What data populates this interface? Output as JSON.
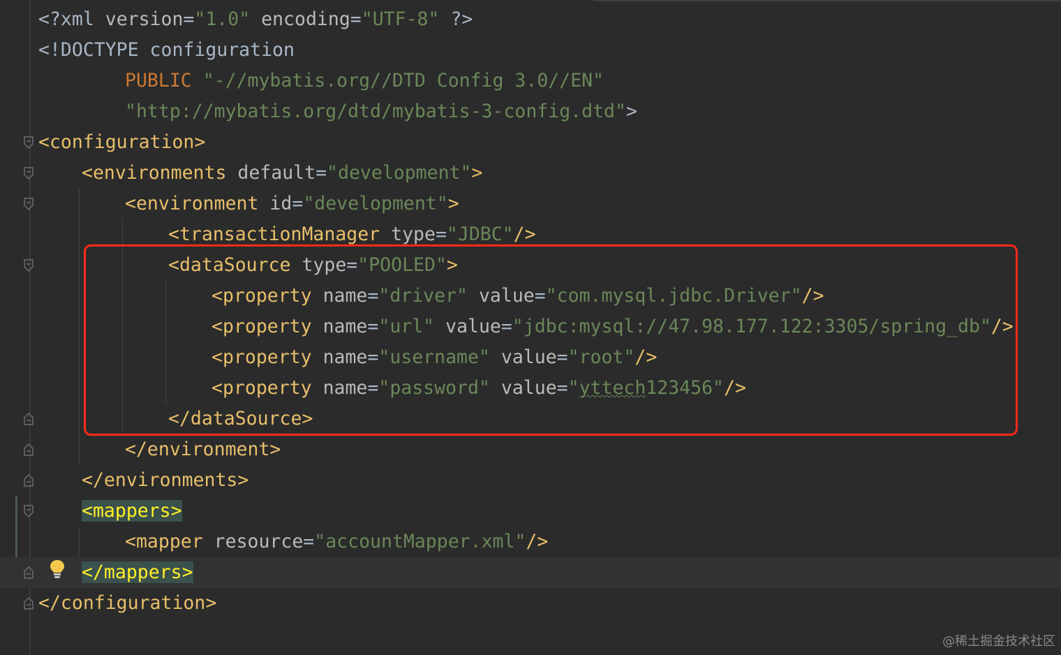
{
  "editor": {
    "lines": [
      {
        "id": "l1",
        "tokens": [
          [
            "plain",
            "<?xml "
          ],
          [
            "attr",
            "version"
          ],
          [
            "eq",
            "="
          ],
          [
            "val",
            "\"1.0\""
          ],
          [
            "plain",
            " "
          ],
          [
            "attr",
            "encoding"
          ],
          [
            "eq",
            "="
          ],
          [
            "val",
            "\"UTF-8\""
          ],
          [
            "plain",
            " ?>"
          ]
        ]
      },
      {
        "id": "l2",
        "tokens": [
          [
            "plain",
            "<!DOCTYPE configuration"
          ]
        ]
      },
      {
        "id": "l3",
        "tokens": [
          [
            "kw",
            "PUBLIC"
          ],
          [
            "plain",
            " "
          ],
          [
            "val",
            "\"-//mybatis.org//DTD Config 3.0//EN\""
          ]
        ]
      },
      {
        "id": "l4",
        "tokens": [
          [
            "val",
            "\"http://mybatis.org/dtd/mybatis-3-config.dtd\""
          ],
          [
            "plain",
            ">"
          ]
        ]
      },
      {
        "id": "l5",
        "tokens": [
          [
            "tag",
            "<configuration>"
          ]
        ]
      },
      {
        "id": "l6",
        "tokens": [
          [
            "tag",
            "<environments"
          ],
          [
            "plain",
            " "
          ],
          [
            "attr",
            "default"
          ],
          [
            "eq",
            "="
          ],
          [
            "val",
            "\"development\""
          ],
          [
            "tag",
            ">"
          ]
        ]
      },
      {
        "id": "l7",
        "tokens": [
          [
            "tag",
            "<environment"
          ],
          [
            "plain",
            " "
          ],
          [
            "attr",
            "id"
          ],
          [
            "eq",
            "="
          ],
          [
            "val",
            "\"development\""
          ],
          [
            "tag",
            ">"
          ]
        ]
      },
      {
        "id": "l8",
        "tokens": [
          [
            "tag",
            "<transactionManager"
          ],
          [
            "plain",
            " "
          ],
          [
            "attr",
            "type"
          ],
          [
            "eq",
            "="
          ],
          [
            "val",
            "\"JDBC\""
          ],
          [
            "tag",
            "/>"
          ]
        ]
      },
      {
        "id": "l9",
        "tokens": [
          [
            "tag",
            "<dataSource"
          ],
          [
            "plain",
            " "
          ],
          [
            "attr",
            "type"
          ],
          [
            "eq",
            "="
          ],
          [
            "val",
            "\"POOLED\""
          ],
          [
            "tag",
            ">"
          ]
        ]
      },
      {
        "id": "l10",
        "tokens": [
          [
            "tag",
            "<property"
          ],
          [
            "plain",
            " "
          ],
          [
            "attr",
            "name"
          ],
          [
            "eq",
            "="
          ],
          [
            "val",
            "\"driver\""
          ],
          [
            "plain",
            " "
          ],
          [
            "attr",
            "value"
          ],
          [
            "eq",
            "="
          ],
          [
            "val",
            "\"com.mysql.jdbc.Driver\""
          ],
          [
            "tag",
            "/>"
          ]
        ]
      },
      {
        "id": "l11",
        "tokens": [
          [
            "tag",
            "<property"
          ],
          [
            "plain",
            " "
          ],
          [
            "attr",
            "name"
          ],
          [
            "eq",
            "="
          ],
          [
            "val",
            "\"url\""
          ],
          [
            "plain",
            " "
          ],
          [
            "attr",
            "value"
          ],
          [
            "eq",
            "="
          ],
          [
            "val",
            "\"jdbc:mysql://47.98.177.122:3305/spring_db\""
          ],
          [
            "tag",
            "/>"
          ]
        ]
      },
      {
        "id": "l12",
        "tokens": [
          [
            "tag",
            "<property"
          ],
          [
            "plain",
            " "
          ],
          [
            "attr",
            "name"
          ],
          [
            "eq",
            "="
          ],
          [
            "val",
            "\"username\""
          ],
          [
            "plain",
            " "
          ],
          [
            "attr",
            "value"
          ],
          [
            "eq",
            "="
          ],
          [
            "val",
            "\"root\""
          ],
          [
            "tag",
            "/>"
          ]
        ]
      },
      {
        "id": "l13",
        "tokens": [
          [
            "tag",
            "<property"
          ],
          [
            "plain",
            " "
          ],
          [
            "attr",
            "name"
          ],
          [
            "eq",
            "="
          ],
          [
            "val",
            "\"password\""
          ],
          [
            "plain",
            " "
          ],
          [
            "attr",
            "value"
          ],
          [
            "eq",
            "="
          ],
          [
            "val",
            "\""
          ],
          [
            "typo",
            "yttech"
          ],
          [
            "val",
            "123456\""
          ],
          [
            "tag",
            "/>"
          ]
        ]
      },
      {
        "id": "l14",
        "tokens": [
          [
            "tag",
            "</dataSource>"
          ]
        ]
      },
      {
        "id": "l15",
        "tokens": [
          [
            "tag",
            "</environment>"
          ]
        ]
      },
      {
        "id": "l16",
        "tokens": [
          [
            "tag",
            "</environments>"
          ]
        ]
      },
      {
        "id": "l17",
        "tokens": [
          [
            "hl",
            "<mappers>"
          ]
        ]
      },
      {
        "id": "l18",
        "tokens": [
          [
            "tag",
            "<mapper"
          ],
          [
            "plain",
            " "
          ],
          [
            "attr",
            "resource"
          ],
          [
            "eq",
            "="
          ],
          [
            "val",
            "\"accountMapper.xml\""
          ],
          [
            "tag",
            "/>"
          ]
        ]
      },
      {
        "id": "l19",
        "tokens": [
          [
            "hl",
            "</mappers>"
          ]
        ]
      },
      {
        "id": "l20",
        "tokens": [
          [
            "tag",
            "</configuration>"
          ]
        ]
      }
    ]
  },
  "colors": {
    "background": "#2b2b2b",
    "tag": "#e8bf6a",
    "attribute": "#bababa",
    "string": "#6a8759",
    "keyword": "#cc7832",
    "highlight_box": "#ff2a1a"
  },
  "icons": {
    "fold_marker": "fold-toggle-icon",
    "intention": "lightbulb-icon"
  },
  "watermark": "@稀土掘金技术社区"
}
